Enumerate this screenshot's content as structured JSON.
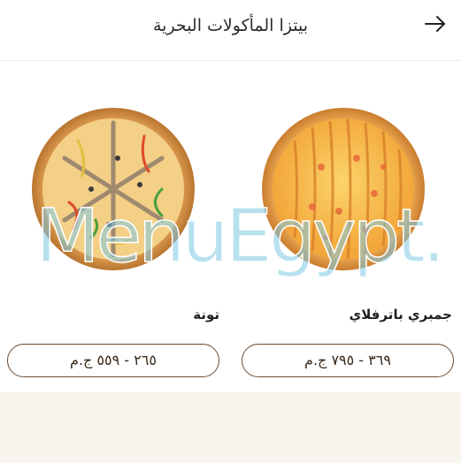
{
  "header": {
    "title": "بيتزا المأكولات البحرية",
    "back_icon": "arrow-right-icon"
  },
  "products": [
    {
      "name": "جمبري باترفلاي",
      "price": "٣٦٩ - ٧٩٥ ج.م"
    },
    {
      "name": "تونة",
      "price": "٢٦٥ - ٥٥٩ ج.م"
    }
  ],
  "watermark": {
    "text": "MenuEgypt.com",
    "color": "#7ec8e3"
  },
  "colors": {
    "accent": "#6b4c34",
    "band": "#f8f4ee"
  }
}
